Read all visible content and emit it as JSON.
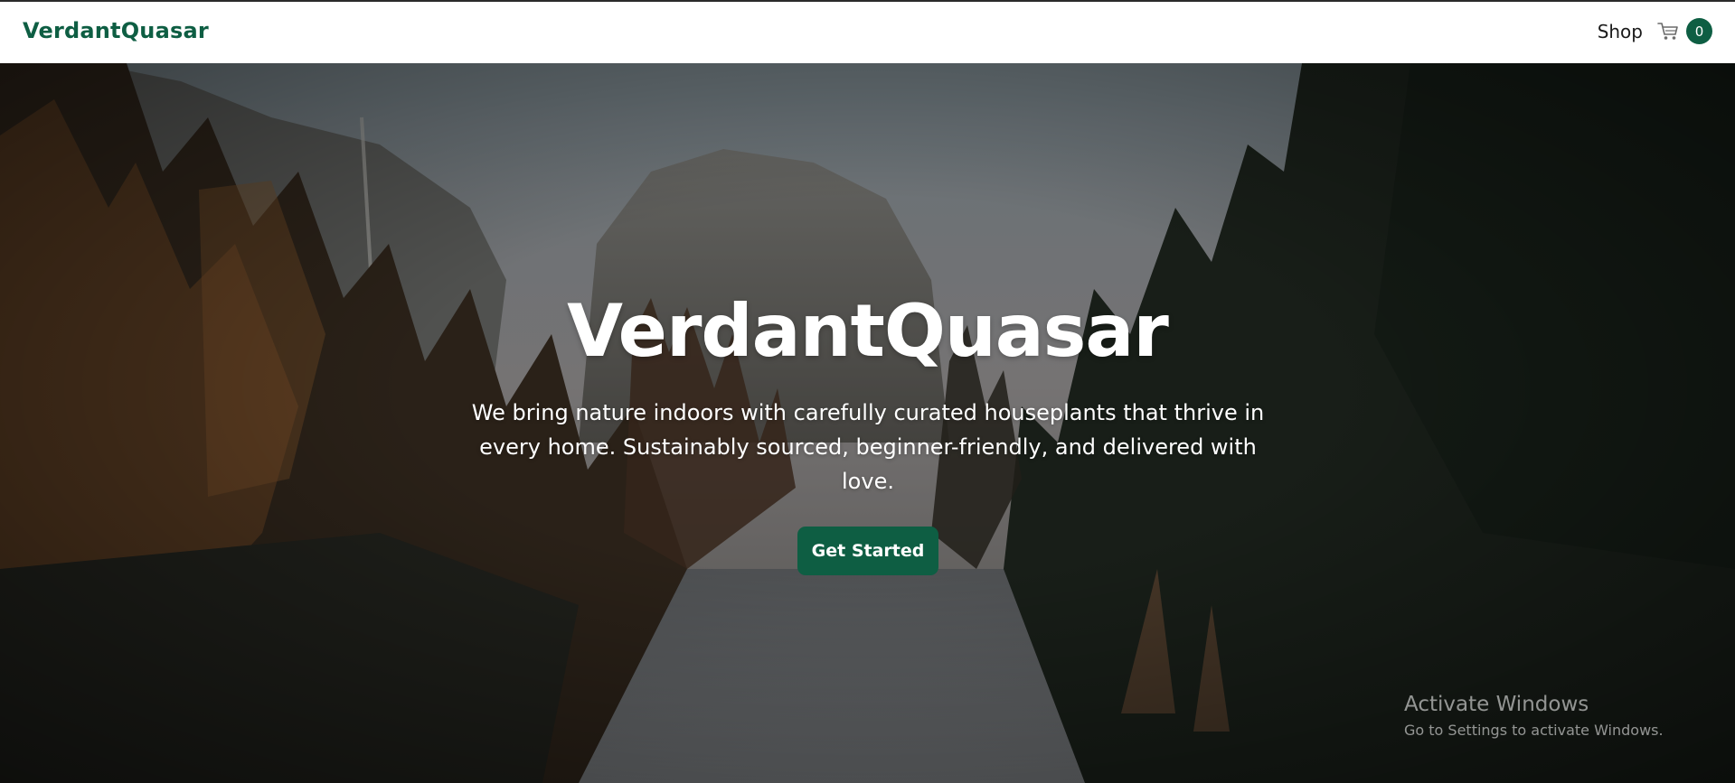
{
  "brand": {
    "name": "VerdantQuasar",
    "color": "#0e5e43"
  },
  "nav": {
    "shop_label": "Shop",
    "cart": {
      "icon": "cart-icon",
      "count": "0"
    }
  },
  "hero": {
    "title": "VerdantQuasar",
    "description": "We bring nature indoors with carefully curated houseplants that thrive in every home. Sustainably sourced, beginner-friendly, and delivered with love.",
    "cta_label": "Get Started",
    "background": "forest-mountain-river-photo"
  },
  "watermark": {
    "title": "Activate Windows",
    "subtitle": "Go to Settings to activate Windows."
  },
  "colors": {
    "accent": "#0e5e43",
    "navbar_bg": "#ffffff",
    "hero_text": "#ffffff"
  }
}
